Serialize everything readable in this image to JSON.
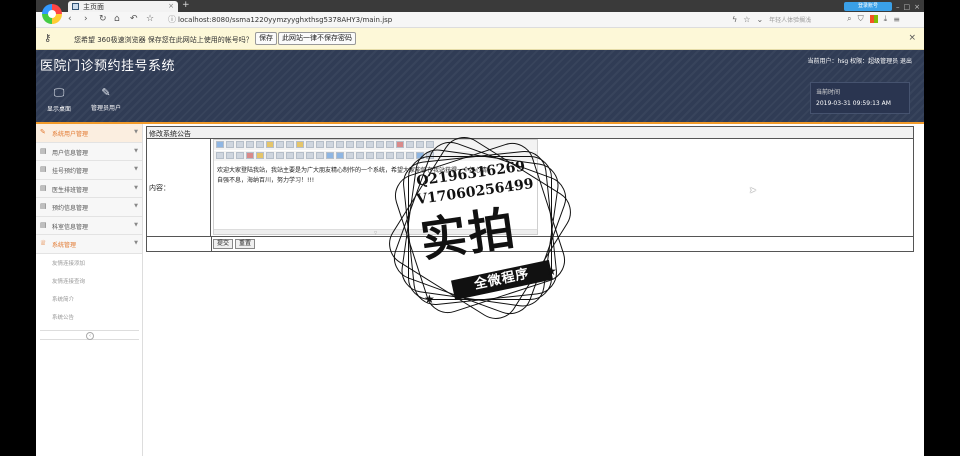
{
  "browser": {
    "tab_title": "主页面",
    "tab_close": "×",
    "new_tab": "+",
    "url": "localhost:8080/ssma1220yymzyyghxthsg5378AHY3/main.jsp",
    "search_placeholder": "年轻人体验搁浅",
    "win_button": "登录账号",
    "nav": {
      "back": "‹",
      "forward": "›",
      "reload": "↻",
      "home": "⌂",
      "undo": "↶",
      "star": "☆"
    }
  },
  "password_bar": {
    "message": "您希望 360极速浏览器 保存您在此网站上使用的帐号吗？",
    "save_label": "保存",
    "never_label": "此网站一律不保存密码",
    "close": "×"
  },
  "app": {
    "title": "医院门诊预约挂号系统",
    "user_info": "当前用户：hsg 权限：超级管理员 退出",
    "nav": [
      {
        "label": "显示桌面",
        "icon": "monitor-icon"
      },
      {
        "label": "管理员用户",
        "icon": "pencil-icon"
      }
    ],
    "time_label": "当前时间",
    "time_value": "2019-03-31 09:59:13 AM"
  },
  "sidebar": {
    "items": [
      {
        "label": "系统用户管理",
        "icon": "✎",
        "state": "active"
      },
      {
        "label": "用户信息管理",
        "icon": "▤",
        "state": ""
      },
      {
        "label": "挂号预约管理",
        "icon": "▤",
        "state": ""
      },
      {
        "label": "医生排班管理",
        "icon": "▤",
        "state": ""
      },
      {
        "label": "预约信息管理",
        "icon": "▤",
        "state": ""
      },
      {
        "label": "科室信息管理",
        "icon": "▤",
        "state": ""
      },
      {
        "label": "系统管理",
        "icon": "♕",
        "state": "active2"
      }
    ],
    "sub_items": [
      "友情连接添加",
      "友情连接查询",
      "系统简介",
      "系统公告"
    ]
  },
  "form": {
    "panel_title": "修改系统公告",
    "content_label": "内容：",
    "editor_lines": [
      "欢迎大家登陆我站，我站主要是为广大朋友精心制作的一个系统，希望大家能够在我站获得一个好心情",
      "自强不息，海纳百川，努力学习！!!!"
    ],
    "submit_label": "提交",
    "reset_label": "重置"
  },
  "watermark": {
    "qq": "Q2196316269",
    "vx": "V17060256499",
    "big": "实拍",
    "ribbon": "全微程序"
  },
  "colors": {
    "accent": "#f19a2a",
    "header": "#303c55",
    "sidebar_active": "#e2772e"
  }
}
